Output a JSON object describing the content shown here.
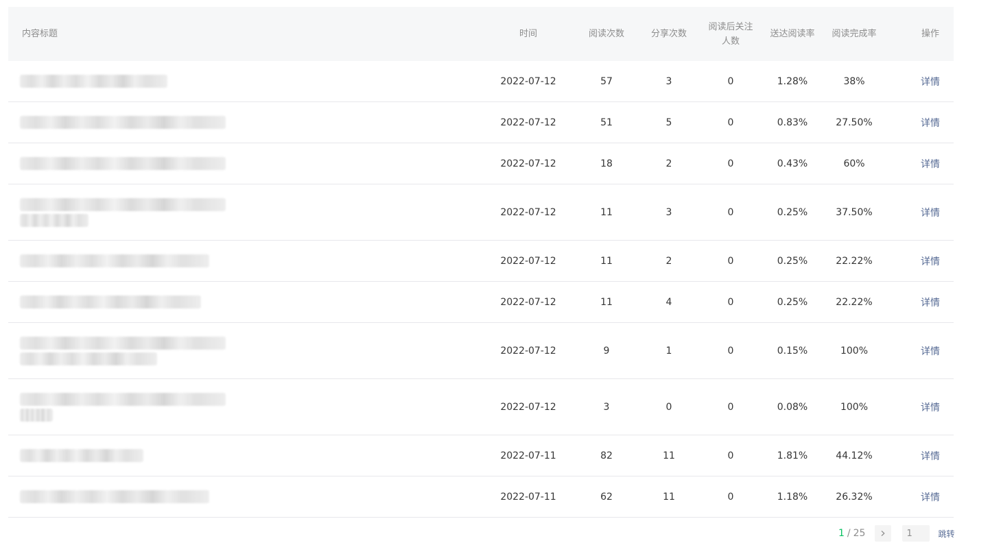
{
  "table": {
    "headers": {
      "title": "内容标题",
      "time": "时间",
      "reads": "阅读次数",
      "shares": "分享次数",
      "follows": "阅读后关注人数",
      "delivery_rate": "送达阅读率",
      "completion_rate": "阅读完成率",
      "action": "操作"
    },
    "rows": [
      {
        "time": "2022-07-12",
        "reads": "57",
        "shares": "3",
        "follows": "0",
        "delivery_rate": "1.28%",
        "completion_rate": "38%",
        "action": "详情"
      },
      {
        "time": "2022-07-12",
        "reads": "51",
        "shares": "5",
        "follows": "0",
        "delivery_rate": "0.83%",
        "completion_rate": "27.50%",
        "action": "详情"
      },
      {
        "time": "2022-07-12",
        "reads": "18",
        "shares": "2",
        "follows": "0",
        "delivery_rate": "0.43%",
        "completion_rate": "60%",
        "action": "详情"
      },
      {
        "time": "2022-07-12",
        "reads": "11",
        "shares": "3",
        "follows": "0",
        "delivery_rate": "0.25%",
        "completion_rate": "37.50%",
        "action": "详情"
      },
      {
        "time": "2022-07-12",
        "reads": "11",
        "shares": "2",
        "follows": "0",
        "delivery_rate": "0.25%",
        "completion_rate": "22.22%",
        "action": "详情"
      },
      {
        "time": "2022-07-12",
        "reads": "11",
        "shares": "4",
        "follows": "0",
        "delivery_rate": "0.25%",
        "completion_rate": "22.22%",
        "action": "详情"
      },
      {
        "time": "2022-07-12",
        "reads": "9",
        "shares": "1",
        "follows": "0",
        "delivery_rate": "0.15%",
        "completion_rate": "100%",
        "action": "详情"
      },
      {
        "time": "2022-07-12",
        "reads": "3",
        "shares": "0",
        "follows": "0",
        "delivery_rate": "0.08%",
        "completion_rate": "100%",
        "action": "详情"
      },
      {
        "time": "2022-07-11",
        "reads": "82",
        "shares": "11",
        "follows": "0",
        "delivery_rate": "1.81%",
        "completion_rate": "44.12%",
        "action": "详情"
      },
      {
        "time": "2022-07-11",
        "reads": "62",
        "shares": "11",
        "follows": "0",
        "delivery_rate": "1.18%",
        "completion_rate": "26.32%",
        "action": "详情"
      }
    ]
  },
  "pagination": {
    "current": "1",
    "separator": "/",
    "total": "25",
    "input_value": "1",
    "jump_label": "跳转",
    "next_icon": "chevron-right-icon"
  },
  "colors": {
    "header_bg": "#f6f7f8",
    "link": "#576b95",
    "current_page": "#07c160",
    "divider": "#e7e7eb"
  }
}
